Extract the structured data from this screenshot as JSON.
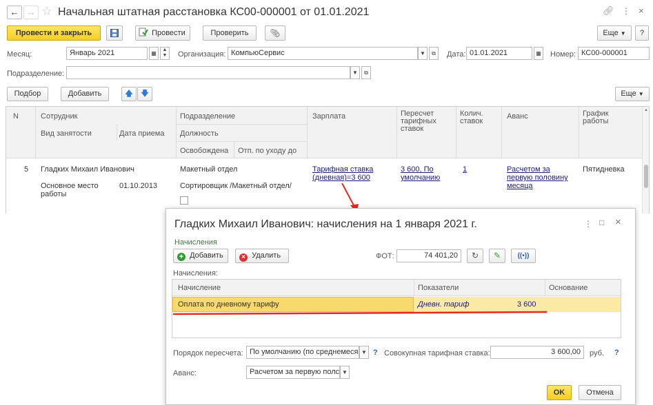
{
  "window": {
    "title": "Начальная штатная расстановка КС00-000001 от 01.01.2021"
  },
  "toolbar": {
    "post_close": "Провести и закрыть",
    "post": "Провести",
    "check": "Проверить",
    "more": "Еще",
    "help": "?"
  },
  "form": {
    "month_label": "Месяц:",
    "month_value": "Январь 2021",
    "org_label": "Организация:",
    "org_value": "КомпьюСервис",
    "date_label": "Дата:",
    "date_value": "01.01.2021",
    "number_label": "Номер:",
    "number_value": "КС00-000001",
    "dept_label": "Подразделение:",
    "dept_value": ""
  },
  "table_toolbar": {
    "select": "Подбор",
    "add": "Добавить",
    "more": "Еще"
  },
  "table": {
    "headers": {
      "n": "N",
      "employee": "Сотрудник",
      "employment_type": "Вид занятости",
      "hire_date": "Дата приема",
      "department": "Подразделение",
      "position": "Должность",
      "released": "Освобождена",
      "parental_leave": "Отп. по уходу до",
      "salary": "Зарплата",
      "recalc_line1": "Пересчет",
      "recalc_line2": "тарифных",
      "recalc_line3": "ставок",
      "count_line1": "Колич.",
      "count_line2": "ставок",
      "advance": "Аванс",
      "schedule_line1": "График",
      "schedule_line2": "работы"
    },
    "row": {
      "n": "5",
      "employee": "Гладких Михаил Иванович",
      "employment_type_line1": "Основное место",
      "employment_type_line2": "работы",
      "hire_date": "01.10.2013",
      "department": "Макетный отдел",
      "position": "Сортировщик /Макетный отдел/",
      "salary_line1": "Тарифная ставка",
      "salary_line2": "(дневная)=3 600",
      "recalc_line1": "3 600, По",
      "recalc_line2": "умолчанию",
      "count": "1",
      "advance_line1": "Расчетом за",
      "advance_line2": "первую половину",
      "advance_line3": "месяца",
      "schedule": "Пятидневка"
    }
  },
  "dialog": {
    "title": "Гладких Михаил Иванович: начисления на 1 января 2021 г.",
    "group_title": "Начисления",
    "add": "Добавить",
    "delete": "Удалить",
    "fot_label": "ФОТ:",
    "fot_value": "74 401,20",
    "accruals_label": "Начисления:",
    "col_accrual": "Начисление",
    "col_indicators": "Показатели",
    "col_basis": "Основание",
    "accrual_name": "Оплата по дневному тарифу",
    "indicator_name": "Дневн. тариф",
    "indicator_value": "3 600",
    "recalc_order_label": "Порядок пересчета:",
    "recalc_order_value": "По умолчанию (по среднемеся",
    "total_rate_label": "Совокупная тарифная ставка:",
    "total_rate_value": "3 600,00",
    "currency": "руб.",
    "advance_label": "Аванс:",
    "advance_value": "Расчетом за первую полс",
    "ok": "OK",
    "cancel": "Отмена",
    "q": "?"
  },
  "colors": {
    "accent_yellow": "#f5cf20",
    "highlight_row": "#fbeaa5",
    "annotation_red": "#e8281e",
    "group_green": "#3c7a3c"
  }
}
